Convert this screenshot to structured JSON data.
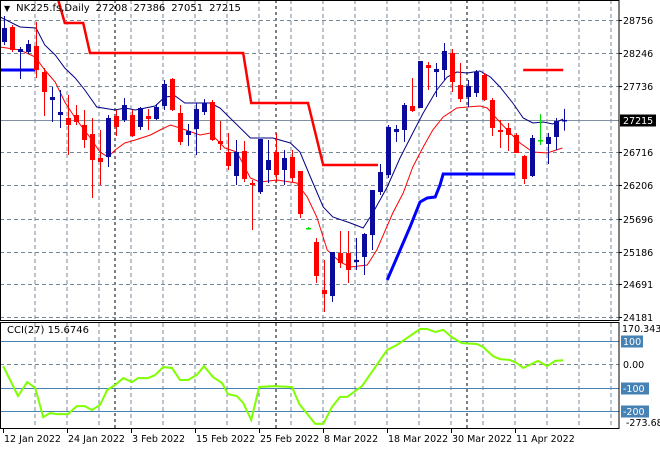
{
  "header": {
    "symbol_timeframe": "NK225.fs,Daily",
    "open": "27208",
    "high": "27386",
    "low": "27051",
    "close": "27215",
    "menu_icon": "triangle-down-icon"
  },
  "colors": {
    "bull": "#0a0a9c",
    "bear": "#ff0000",
    "doji": "#00e000",
    "ma_upper": "#000080",
    "ma_lower": "#ff0000",
    "step_upper": "#ff0000",
    "step_lower": "#0000ff",
    "cci": "#7fff00",
    "cci_level": "#4682b4",
    "grid": "#778899"
  },
  "chart_data": {
    "type": "candlestick",
    "title": "NK225.fs,Daily",
    "price_ticks": [
      "28756",
      "28246",
      "27736",
      "26716",
      "26206",
      "25696",
      "25186",
      "24691",
      "24181"
    ],
    "price_range": [
      24181,
      28756
    ],
    "current_price": "27215",
    "x_tick_labels": [
      {
        "bar": -0.1,
        "label": "12 Jan 2022"
      },
      {
        "bar": 7.9,
        "label": "24 Jan 2022"
      },
      {
        "bar": 15.9,
        "label": "3 Feb 2022"
      },
      {
        "bar": 23.9,
        "label": "15 Feb 2022"
      },
      {
        "bar": 31.9,
        "label": "25 Feb 2022"
      },
      {
        "bar": 39.9,
        "label": "8 Mar 2022"
      },
      {
        "bar": 47.9,
        "label": "18 Mar 2022"
      },
      {
        "bar": 55.9,
        "label": "30 Mar 2022"
      },
      {
        "bar": 63.9,
        "label": "11 Apr 2022"
      }
    ],
    "separator_bars": [
      13.9,
      34,
      57.9
    ],
    "candles": [
      [
        28417,
        28817,
        28371,
        28633
      ],
      [
        28648,
        28679,
        28263,
        28294
      ],
      [
        28263,
        28340,
        27847,
        28309
      ],
      [
        28263,
        28448,
        28232,
        28386
      ],
      [
        28355,
        28725,
        27862,
        27985
      ],
      [
        27954,
        28016,
        27276,
        27646
      ],
      [
        27523,
        27723,
        27184,
        27569
      ],
      [
        27292,
        27677,
        27092,
        27338
      ],
      [
        27246,
        27600,
        26675,
        27138
      ],
      [
        27292,
        27446,
        27138,
        27184
      ],
      [
        27138,
        27369,
        26783,
        26907
      ],
      [
        26999,
        27246,
        26013,
        26598
      ],
      [
        26629,
        27061,
        26213,
        26568
      ],
      [
        26645,
        27292,
        26491,
        27246
      ],
      [
        27276,
        27369,
        26968,
        27107
      ],
      [
        27215,
        27554,
        27184,
        27446
      ],
      [
        27292,
        27369,
        26953,
        26968
      ],
      [
        27107,
        27415,
        27061,
        27400
      ],
      [
        27276,
        27384,
        27061,
        27230
      ],
      [
        27230,
        27461,
        27215,
        27415
      ],
      [
        27431,
        27831,
        27369,
        27770
      ],
      [
        27847,
        27862,
        27354,
        27369
      ],
      [
        27323,
        27446,
        26830,
        26876
      ],
      [
        26984,
        27153,
        26814,
        27045
      ],
      [
        27076,
        27477,
        26675,
        27384
      ],
      [
        27338,
        27538,
        27292,
        27477
      ],
      [
        27492,
        27523,
        26891,
        26907
      ],
      [
        26891,
        27199,
        26752,
        26845
      ],
      [
        26722,
        27014,
        26444,
        26506
      ],
      [
        26352,
        26907,
        26213,
        26722
      ],
      [
        26737,
        26891,
        26259,
        26306
      ],
      [
        26244,
        26290,
        25519,
        26213
      ],
      [
        26105,
        26922,
        26074,
        26922
      ],
      [
        26444,
        26907,
        26244,
        26598
      ],
      [
        26722,
        27014,
        26259,
        26367
      ],
      [
        26444,
        26752,
        26213,
        26629
      ],
      [
        26645,
        26752,
        26259,
        26321
      ],
      [
        26429,
        26429,
        25704,
        25766
      ],
      [
        25550,
        25565,
        25535,
        25550
      ],
      [
        25335,
        25396,
        24703,
        24811
      ],
      [
        24594,
        25058,
        24256,
        24533
      ],
      [
        24502,
        25181,
        24410,
        25181
      ],
      [
        25165,
        25504,
        24934,
        25011
      ],
      [
        25165,
        25504,
        24703,
        24903
      ],
      [
        25027,
        25396,
        24903,
        25058
      ],
      [
        25104,
        25473,
        24826,
        25458
      ],
      [
        25442,
        26136,
        25212,
        26136
      ],
      [
        26105,
        26537,
        26059,
        26413
      ],
      [
        26367,
        27138,
        26321,
        27107
      ],
      [
        27030,
        27138,
        26876,
        27076
      ],
      [
        27061,
        27477,
        26876,
        27446
      ],
      [
        27431,
        27862,
        27338,
        27354
      ],
      [
        27400,
        28124,
        27400,
        28124
      ],
      [
        28062,
        28109,
        27677,
        28016
      ],
      [
        27954,
        28093,
        27569,
        28001
      ],
      [
        27985,
        28401,
        27831,
        28278
      ],
      [
        28247,
        28309,
        27646,
        27800
      ],
      [
        27754,
        28093,
        27492,
        27538
      ],
      [
        27569,
        27831,
        27415,
        27739
      ],
      [
        27631,
        27985,
        27569,
        27954
      ],
      [
        27908,
        27939,
        27508,
        27523
      ],
      [
        27523,
        27554,
        26968,
        27092
      ],
      [
        27061,
        27215,
        26783,
        27030
      ],
      [
        27092,
        27169,
        26737,
        26984
      ],
      [
        26984,
        27014,
        26706,
        26706
      ],
      [
        26660,
        26675,
        26229,
        26306
      ],
      [
        26352,
        26984,
        26336,
        26937
      ],
      [
        26907,
        27307,
        26830,
        26907
      ],
      [
        26845,
        27014,
        26537,
        26953
      ],
      [
        26953,
        27246,
        26752,
        27199
      ],
      [
        27208,
        27386,
        27051,
        27215
      ]
    ],
    "indicators": {
      "ma_upper": [
        [
          -0.5,
          28802
        ],
        [
          2,
          28648
        ],
        [
          4,
          28633
        ],
        [
          5.1,
          28371
        ],
        [
          6.4,
          28216
        ],
        [
          7.6,
          28016
        ],
        [
          8.9,
          27862
        ],
        [
          10.1,
          27677
        ],
        [
          11.6,
          27415
        ],
        [
          13.9,
          27369
        ],
        [
          15.1,
          27400
        ],
        [
          16.4,
          27369
        ],
        [
          18.9,
          27431
        ],
        [
          20.1,
          27569
        ],
        [
          21.4,
          27585
        ],
        [
          22.6,
          27477
        ],
        [
          25.8,
          27477
        ],
        [
          27,
          27400
        ],
        [
          30.8,
          26937
        ],
        [
          33.6,
          26937
        ],
        [
          35.8,
          26860
        ],
        [
          37,
          26722
        ],
        [
          38.3,
          26336
        ],
        [
          39.9,
          25874
        ],
        [
          41.1,
          25720
        ],
        [
          43.3,
          25628
        ],
        [
          44.9,
          25550
        ],
        [
          46.1,
          25782
        ],
        [
          47.9,
          26182
        ],
        [
          49.5,
          26629
        ],
        [
          51.1,
          27014
        ],
        [
          52.4,
          27323
        ],
        [
          54.1,
          27677
        ],
        [
          55.4,
          27877
        ],
        [
          56.6,
          27954
        ],
        [
          57.9,
          27939
        ],
        [
          59.5,
          27970
        ],
        [
          60.8,
          27877
        ],
        [
          62,
          27723
        ],
        [
          63.6,
          27477
        ],
        [
          64.9,
          27246
        ],
        [
          66.1,
          27169
        ],
        [
          67.4,
          27184
        ],
        [
          68.6,
          27153
        ],
        [
          69.9,
          27230
        ]
      ],
      "ma_lower": [
        [
          -0.5,
          28340
        ],
        [
          2,
          28294
        ],
        [
          3.9,
          28186
        ],
        [
          5.1,
          27985
        ],
        [
          6.4,
          27800
        ],
        [
          7.6,
          27492
        ],
        [
          8.9,
          27246
        ],
        [
          10.8,
          26937
        ],
        [
          12,
          26722
        ],
        [
          13,
          26645
        ],
        [
          13.9,
          26752
        ],
        [
          15.1,
          26860
        ],
        [
          16.4,
          26907
        ],
        [
          18.3,
          26984
        ],
        [
          19.5,
          27061
        ],
        [
          20.8,
          27138
        ],
        [
          22,
          27092
        ],
        [
          24.5,
          26984
        ],
        [
          25.8,
          27014
        ],
        [
          27.6,
          26783
        ],
        [
          29.1,
          26722
        ],
        [
          30.8,
          26321
        ],
        [
          32,
          26259
        ],
        [
          34.1,
          26290
        ],
        [
          36.6,
          26244
        ],
        [
          37.9,
          26028
        ],
        [
          39.1,
          25720
        ],
        [
          40.4,
          25212
        ],
        [
          42,
          25027
        ],
        [
          43.3,
          24950
        ],
        [
          45.4,
          24981
        ],
        [
          46.6,
          25212
        ],
        [
          48.6,
          25782
        ],
        [
          49.9,
          26090
        ],
        [
          51.1,
          26491
        ],
        [
          52.4,
          26799
        ],
        [
          53.6,
          27061
        ],
        [
          54.9,
          27261
        ],
        [
          56.6,
          27400
        ],
        [
          57.9,
          27415
        ],
        [
          59.5,
          27431
        ],
        [
          60.4,
          27400
        ],
        [
          61.4,
          27261
        ],
        [
          62.9,
          27061
        ],
        [
          64.5,
          26860
        ],
        [
          66.1,
          26722
        ],
        [
          67.9,
          26706
        ],
        [
          69.8,
          26783
        ]
      ],
      "step_upper": [
        [
          [
            6.6,
            29141
          ],
          [
            7.6,
            28710
          ],
          [
            9.9,
            28710
          ],
          [
            10.75,
            28247
          ],
          [
            29.9,
            28247
          ],
          [
            30.9,
            27477
          ],
          [
            38,
            27477
          ],
          [
            39.9,
            26521
          ],
          [
            46.75,
            26521
          ]
        ],
        [
          [
            64.9,
            27985
          ],
          [
            69.9,
            27985
          ]
        ]
      ],
      "step_lower": [
        [
          [
            -0.5,
            27985
          ],
          [
            3.9,
            27985
          ]
        ],
        [
          [
            47.9,
            24749
          ],
          [
            50.75,
            25566
          ],
          [
            52,
            25951
          ],
          [
            52.9,
            26013
          ],
          [
            53.9,
            26028
          ],
          [
            54.5,
            26213
          ],
          [
            54.9,
            26383
          ],
          [
            63.9,
            26383
          ]
        ]
      ]
    },
    "cci": {
      "label": "CCI(27) 15.6746",
      "axis_max": "170.3435",
      "axis_min": "-273.680",
      "levels": [
        {
          "value": 100,
          "label": "100"
        },
        {
          "value": 0,
          "label": "0.00"
        },
        {
          "value": -100,
          "label": "-100"
        },
        {
          "value": -200,
          "label": "-200"
        }
      ],
      "points": [
        [
          -0.1,
          -9
        ],
        [
          1.75,
          -136
        ],
        [
          2.9,
          -77
        ],
        [
          3.9,
          -102
        ],
        [
          4.9,
          -226
        ],
        [
          5.75,
          -209
        ],
        [
          6.6,
          -213
        ],
        [
          8,
          -213
        ],
        [
          9.1,
          -179
        ],
        [
          10.1,
          -179
        ],
        [
          11,
          -196
        ],
        [
          12,
          -174
        ],
        [
          12.9,
          -111
        ],
        [
          13.9,
          -89
        ],
        [
          14.9,
          -60
        ],
        [
          16,
          -77
        ],
        [
          16.75,
          -60
        ],
        [
          18,
          -60
        ],
        [
          18.9,
          -47
        ],
        [
          19.9,
          -13
        ],
        [
          21,
          -17
        ],
        [
          22,
          -68
        ],
        [
          23,
          -68
        ],
        [
          24.1,
          -47
        ],
        [
          25,
          -9
        ],
        [
          26.1,
          -55
        ],
        [
          27.25,
          -81
        ],
        [
          28,
          -128
        ],
        [
          29.1,
          -136
        ],
        [
          29.9,
          -166
        ],
        [
          30.9,
          -238
        ],
        [
          31.9,
          -98
        ],
        [
          33.6,
          -94
        ],
        [
          36,
          -98
        ],
        [
          36.9,
          -170
        ],
        [
          38.9,
          -255
        ],
        [
          39.9,
          -255
        ],
        [
          41,
          -183
        ],
        [
          42,
          -140
        ],
        [
          42.9,
          -140
        ],
        [
          44.75,
          -94
        ],
        [
          47.9,
          60
        ],
        [
          49.1,
          81
        ],
        [
          50.75,
          119
        ],
        [
          52,
          149
        ],
        [
          52.9,
          149
        ],
        [
          53.9,
          136
        ],
        [
          54.9,
          145
        ],
        [
          56.1,
          111
        ],
        [
          57.25,
          89
        ],
        [
          59.1,
          85
        ],
        [
          59.9,
          72
        ],
        [
          61.1,
          34
        ],
        [
          62,
          21
        ],
        [
          63.25,
          17
        ],
        [
          64.1,
          4
        ],
        [
          64.9,
          -17
        ],
        [
          66.75,
          13
        ],
        [
          67.9,
          -9
        ],
        [
          68.9,
          13
        ],
        [
          69.9,
          15.67
        ]
      ]
    }
  }
}
